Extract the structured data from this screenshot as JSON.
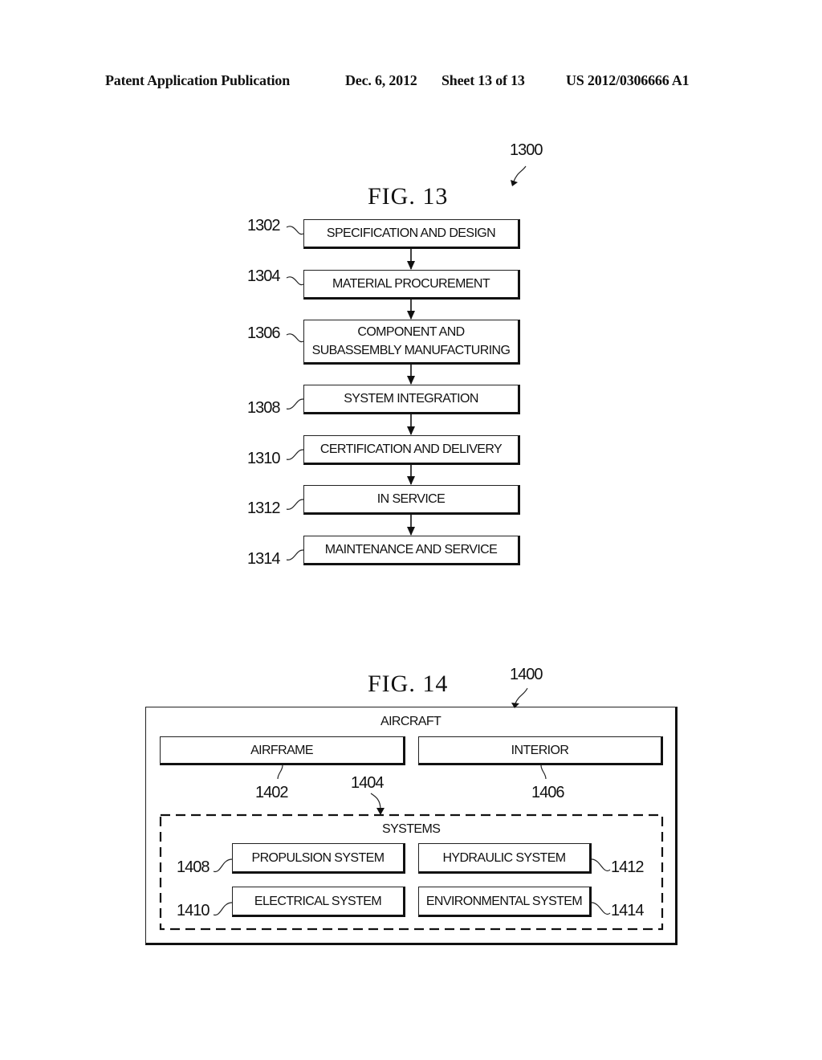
{
  "header": {
    "publication": "Patent Application Publication",
    "date": "Dec. 6, 2012",
    "sheet": "Sheet 13 of 13",
    "number": "US 2012/0306666 A1"
  },
  "fig13": {
    "title": "FIG. 13",
    "ref": "1300",
    "steps": [
      {
        "ref": "1302",
        "label": "SPECIFICATION AND DESIGN"
      },
      {
        "ref": "1304",
        "label": "MATERIAL PROCUREMENT"
      },
      {
        "ref": "1306",
        "label_line1": "COMPONENT AND",
        "label_line2": "SUBASSEMBLY MANUFACTURING"
      },
      {
        "ref": "1308",
        "label": "SYSTEM INTEGRATION"
      },
      {
        "ref": "1310",
        "label": "CERTIFICATION AND DELIVERY"
      },
      {
        "ref": "1312",
        "label": "IN SERVICE"
      },
      {
        "ref": "1314",
        "label": "MAINTENANCE AND SERVICE"
      }
    ]
  },
  "fig14": {
    "title": "FIG. 14",
    "ref": "1400",
    "aircraft_label": "AIRCRAFT",
    "airframe": {
      "ref": "1402",
      "label": "AIRFRAME"
    },
    "interior": {
      "ref": "1406",
      "label": "INTERIOR"
    },
    "systems": {
      "ref": "1404",
      "label": "SYSTEMS",
      "items": [
        {
          "ref": "1408",
          "label": "PROPULSION SYSTEM"
        },
        {
          "ref": "1412",
          "label": "HYDRAULIC SYSTEM"
        },
        {
          "ref": "1410",
          "label": "ELECTRICAL SYSTEM"
        },
        {
          "ref": "1414",
          "label": "ENVIRONMENTAL SYSTEM"
        }
      ]
    }
  }
}
